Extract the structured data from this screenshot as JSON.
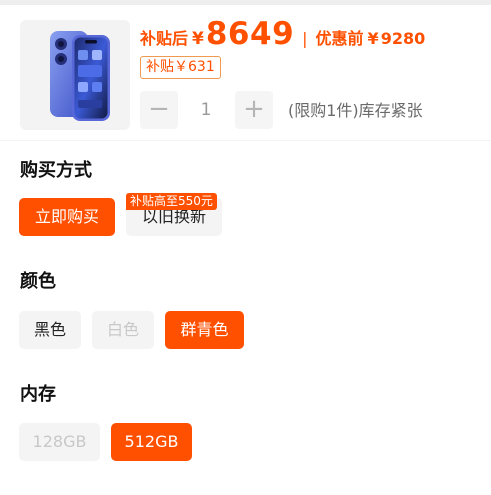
{
  "product": {
    "image_icon": "phone-product-image",
    "subsidy_price_label": "补贴后",
    "currency": "¥",
    "subsidy_price": "8649",
    "divider": "|",
    "original_price_label": "优惠前",
    "original_price": "9280",
    "subsidy_tag": "补贴￥631"
  },
  "quantity": {
    "minus": "−",
    "value": "1",
    "plus": "+",
    "note": "(限购1件)库存紧张"
  },
  "purchase_method": {
    "title": "购买方式",
    "options": [
      {
        "label": "立即购买",
        "state": "selected"
      },
      {
        "label": "以旧换新",
        "state": "normal",
        "badge": "补贴高至550元"
      }
    ]
  },
  "color": {
    "title": "颜色",
    "options": [
      {
        "label": "黑色",
        "state": "normal"
      },
      {
        "label": "白色",
        "state": "disabled"
      },
      {
        "label": "群青色",
        "state": "selected"
      }
    ]
  },
  "storage": {
    "title": "内存",
    "options": [
      {
        "label": "128GB",
        "state": "disabled"
      },
      {
        "label": "512GB",
        "state": "selected"
      }
    ]
  },
  "colors": {
    "accent": "#ff5000",
    "option_bg": "#f4f4f4",
    "disabled_text": "#c8c8c8"
  }
}
